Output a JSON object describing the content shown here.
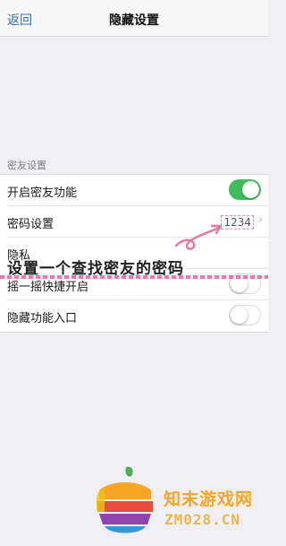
{
  "navbar": {
    "back_label": "返回",
    "title": "隐藏设置"
  },
  "section": {
    "header": "密友设置"
  },
  "settings": [
    {
      "label": "开启密友功能",
      "control": "toggle",
      "on": true
    },
    {
      "label": "密码设置",
      "control": "value",
      "value": "1234"
    },
    {
      "label": "隐私",
      "control": "none"
    },
    {
      "label": "摇一摇快捷开启",
      "control": "toggle",
      "on": false
    },
    {
      "label": "隐藏功能入口",
      "control": "toggle",
      "on": false
    }
  ],
  "annotation": {
    "text": "设置一个查找密友的密码",
    "color": "#e57ba3"
  },
  "watermark": {
    "name_cn": "知末游戏网",
    "domain": "ZM028.CN"
  },
  "colors": {
    "toggle_on": "#3fbd5c",
    "link": "#3b6fb3"
  }
}
